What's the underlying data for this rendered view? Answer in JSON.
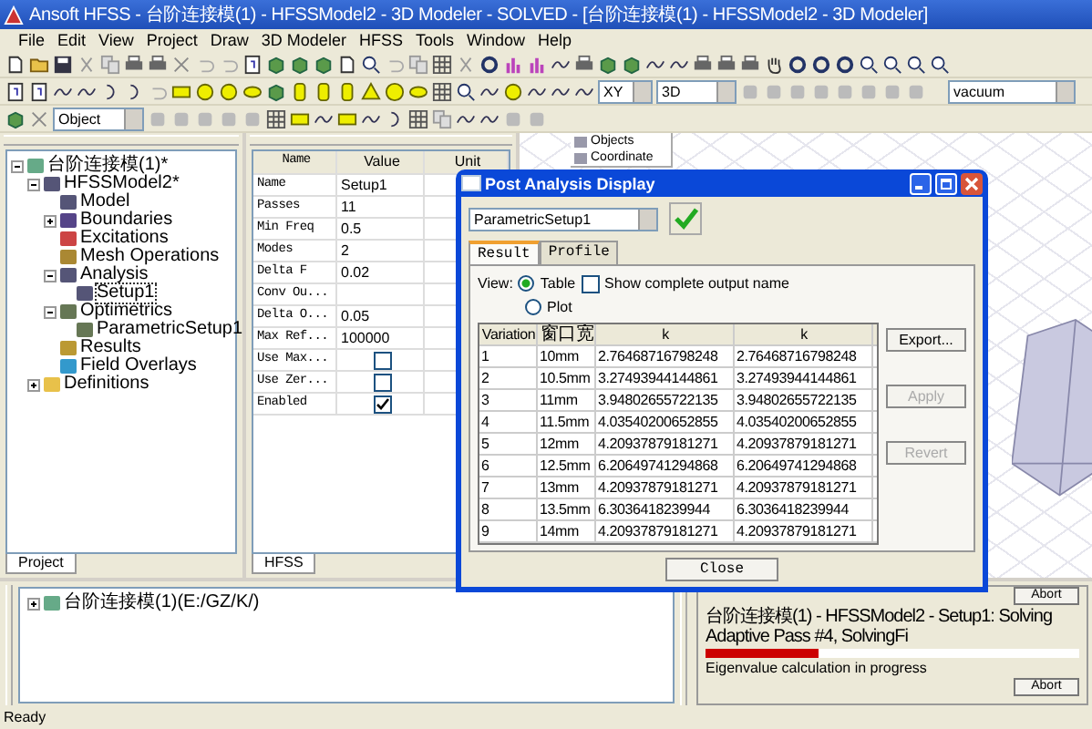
{
  "window": {
    "title": "Ansoft HFSS - 台阶连接模(1) - HFSSModel2 - 3D Modeler - SOLVED - [台阶连接模(1) - HFSSModel2 - 3D Modeler]"
  },
  "menu": [
    "File",
    "Edit",
    "View",
    "Project",
    "Draw",
    "3D Modeler",
    "HFSS",
    "Tools",
    "Window",
    "Help"
  ],
  "toolbar": {
    "object_combo": "Object",
    "plane_combo": "XY",
    "view_combo": "3D",
    "material_combo": "vacuum"
  },
  "project_tree": [
    {
      "label": "台阶连接模(1)*",
      "expanded": true,
      "selected": false,
      "children": [
        {
          "label": "HFSSModel2*",
          "expanded": true,
          "selected": false,
          "children": [
            {
              "label": "Model",
              "selected": false
            },
            {
              "label": "Boundaries",
              "expanded": false,
              "selected": false
            },
            {
              "label": "Excitations",
              "selected": false
            },
            {
              "label": "Mesh Operations",
              "selected": false
            },
            {
              "label": "Analysis",
              "expanded": true,
              "selected": false,
              "children": [
                {
                  "label": "Setup1",
                  "selected": true
                }
              ]
            },
            {
              "label": "Optimetrics",
              "expanded": true,
              "selected": false,
              "children": [
                {
                  "label": "ParametricSetup1",
                  "selected": false
                }
              ]
            },
            {
              "label": "Results",
              "selected": false
            },
            {
              "label": "Field Overlays",
              "selected": false
            }
          ]
        },
        {
          "label": "Definitions",
          "expanded": false,
          "selected": false
        }
      ]
    }
  ],
  "project_tab": "Project",
  "properties": {
    "columns": [
      "Name",
      "Value",
      "Unit"
    ],
    "rows": [
      {
        "kind": "text",
        "name": "Name",
        "value": "Setup1"
      },
      {
        "kind": "text",
        "name": "Passes",
        "value": "11"
      },
      {
        "kind": "text",
        "name": "Min Freq",
        "value": "0.5"
      },
      {
        "kind": "text",
        "name": "Modes",
        "value": "2"
      },
      {
        "kind": "text",
        "name": "Delta F",
        "value": "0.02"
      },
      {
        "kind": "text",
        "name": "Conv Ou...",
        "value": ""
      },
      {
        "kind": "text",
        "name": "Delta O...",
        "value": "0.05"
      },
      {
        "kind": "text",
        "name": "Max Ref...",
        "value": "100000"
      },
      {
        "kind": "checkbox",
        "name": "Use Max...",
        "checked": false
      },
      {
        "kind": "checkbox",
        "name": "Use Zer...",
        "checked": false
      },
      {
        "kind": "checkbox",
        "name": "Enabled",
        "checked": true
      }
    ]
  },
  "properties_tab": "HFSS",
  "modeler_tree": [
    "Objects",
    "Coordinate"
  ],
  "dialog": {
    "title": "Post Analysis Display",
    "setup_combo": "ParametricSetup1",
    "tabs": [
      {
        "label": "Result",
        "selected": true
      },
      {
        "label": "Profile",
        "selected": false
      }
    ],
    "view_label": "View:",
    "view_options": [
      {
        "label": "Table",
        "selected": true
      },
      {
        "label": "Plot",
        "selected": false
      }
    ],
    "show_complete": {
      "label": "Show complete output name",
      "checked": false
    },
    "table": {
      "columns": [
        "Variation",
        "窗口宽",
        "k",
        "k"
      ],
      "rows": [
        [
          "1",
          "10mm",
          "2.76468716798248",
          "2.76468716798248"
        ],
        [
          "2",
          "10.5mm",
          "3.27493944144861",
          "3.27493944144861"
        ],
        [
          "3",
          "11mm",
          "3.94802655722135",
          "3.94802655722135"
        ],
        [
          "4",
          "11.5mm",
          "4.03540200652855",
          "4.03540200652855"
        ],
        [
          "5",
          "12mm",
          "4.20937879181271",
          "4.20937879181271"
        ],
        [
          "6",
          "12.5mm",
          "6.20649741294868",
          "6.20649741294868"
        ],
        [
          "7",
          "13mm",
          "4.20937879181271",
          "4.20937879181271"
        ],
        [
          "8",
          "13.5mm",
          "6.3036418239944",
          "6.3036418239944"
        ],
        [
          "9",
          "14mm",
          "4.20937879181271",
          "4.20937879181271"
        ]
      ]
    },
    "buttons": [
      {
        "label": "Export...",
        "disabled": false
      },
      {
        "label": "Apply",
        "disabled": true
      },
      {
        "label": "Revert",
        "disabled": true
      }
    ],
    "close_button": "Close"
  },
  "messages": [
    {
      "label": "台阶连接模(1)(E:/GZ/K/)",
      "expanded": false
    }
  ],
  "progress": {
    "abort_top": "Abort",
    "task": "台阶连接模(1) - HFSSModel2 - Setup1: Solving Adaptive Pass #4, SolvingFi",
    "level": 0.3,
    "detail": "Eigenvalue calculation in progress",
    "abort_bottom": "Abort"
  },
  "status_bar": "Ready"
}
